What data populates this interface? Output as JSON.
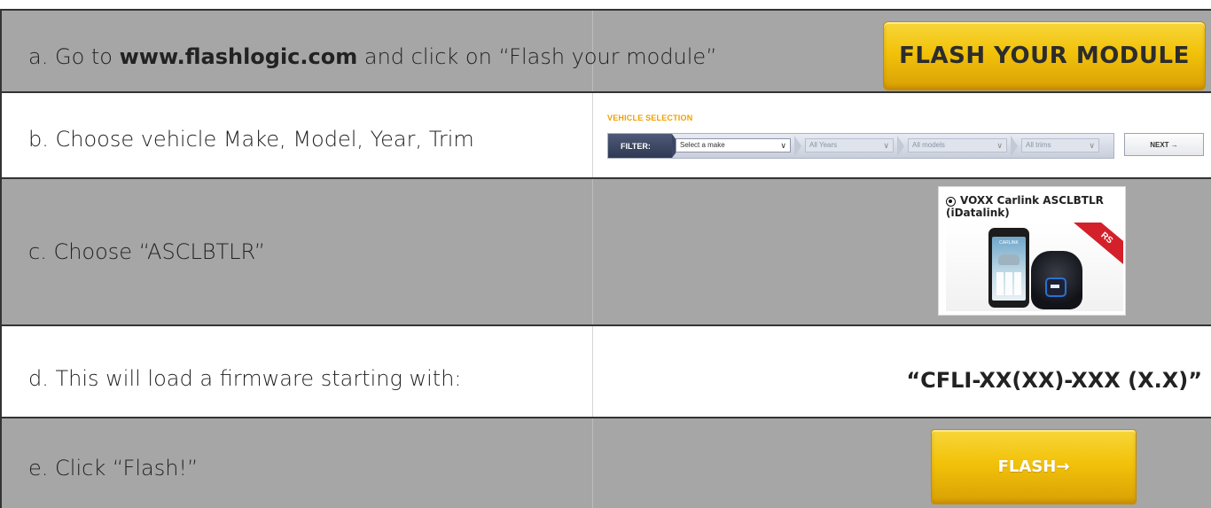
{
  "steps": {
    "a": {
      "prefix": "a.  Go to ",
      "link": "www.flashlogic.com",
      "suffix": " and click on “Flash your module”"
    },
    "b": {
      "text": "b.  Choose vehicle Make, Model, Year, Trim"
    },
    "c": {
      "text": "c.  Choose “ASCLBTLR”"
    },
    "d": {
      "text": "d.  This will load a firmware starting with:",
      "firmware": "“CFLI-XX(XX)-XXX (X.X)”"
    },
    "e": {
      "text": "e.  Click “Flash!”"
    }
  },
  "flash_module_button": {
    "label": "FLASH YOUR MODULE"
  },
  "vehicle_selection": {
    "title": "VEHICLE SELECTION",
    "filter_label": "FILTER:",
    "make": "Select a make",
    "year": "All Years",
    "model": "All models",
    "trim": "All trims",
    "next_label": "NEXT →"
  },
  "product_card": {
    "name": "VOXX Carlink ASCLBTLR",
    "sub": "(iDatalink)",
    "screen_text": "CARLINK",
    "ribbon": "RS",
    "selected": true
  },
  "flash_button": {
    "label": "FLASH→"
  },
  "colors": {
    "accent_yellow": "#f2c20a",
    "row_gray": "#a6a6a6",
    "vehicle_title": "#f0a000",
    "ribbon_red": "#d4202a"
  }
}
